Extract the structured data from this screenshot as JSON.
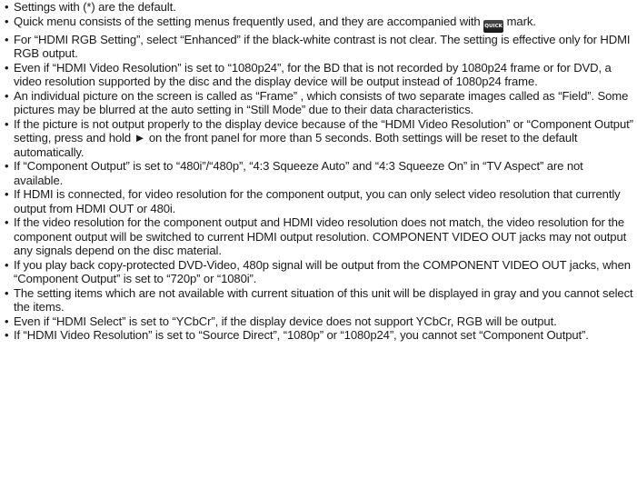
{
  "notes": [
    {
      "text": "Settings with (*) are the default."
    },
    {
      "before": "Quick menu consists of the setting menus frequently used, and they are accompanied with ",
      "badge": "QUICK",
      "after": " mark."
    },
    {
      "text": "For “HDMI RGB Setting”, select “Enhanced” if the black-white contrast is not clear. The setting is effective only for HDMI RGB output."
    },
    {
      "text": "Even if “HDMI Video Resolution” is set to “1080p24”, for the BD that is not recorded by 1080p24 frame or for DVD, a video resolution supported by the disc and the display device will be output instead of 1080p24 frame."
    },
    {
      "text": "An individual picture on the screen is called as “Frame” , which consists of two separate images called as “Field”. Some pictures may be blurred at the auto setting in “Still Mode” due to their data characteristics."
    },
    {
      "before": "If the picture is not output properly to the display device because of the “HDMI Video Resolution” or “Component Output” setting, press and hold ",
      "arrow": "►",
      "after": " on the front panel for more than 5 seconds. Both settings will be reset to the default automatically."
    },
    {
      "text": "If “Component Output” is set to “480i”/“480p”, “4:3 Squeeze Auto” and “4:3 Squeeze On” in “TV Aspect” are not available."
    },
    {
      "text": "If HDMI is connected, for video resolution for the component output, you can only select video resolution that currently output from HDMI OUT or 480i."
    },
    {
      "text": "If the video resolution for the component output and HDMI video resolution does not match, the video resolution for the component output will be switched to current HDMI output resolution. COMPONENT VIDEO OUT jacks may not output any signals depend on the disc material."
    },
    {
      "text": "If you play back copy-protected DVD-Video, 480p signal will be output from the COMPONENT VIDEO OUT jacks, when “Component Output” is set to “720p” or “1080i”."
    },
    {
      "text": "The setting items which are not available with current situation of this unit will be displayed in gray and you cannot select the items."
    },
    {
      "text": "Even if “HDMI Select” is set to “YCbCr”, if the display device does not support YCbCr, RGB will be output."
    },
    {
      "text": "If “HDMI Video Resolution” is set to “Source Direct”, “1080p” or “1080p24”, you cannot set “Component Output”."
    }
  ]
}
